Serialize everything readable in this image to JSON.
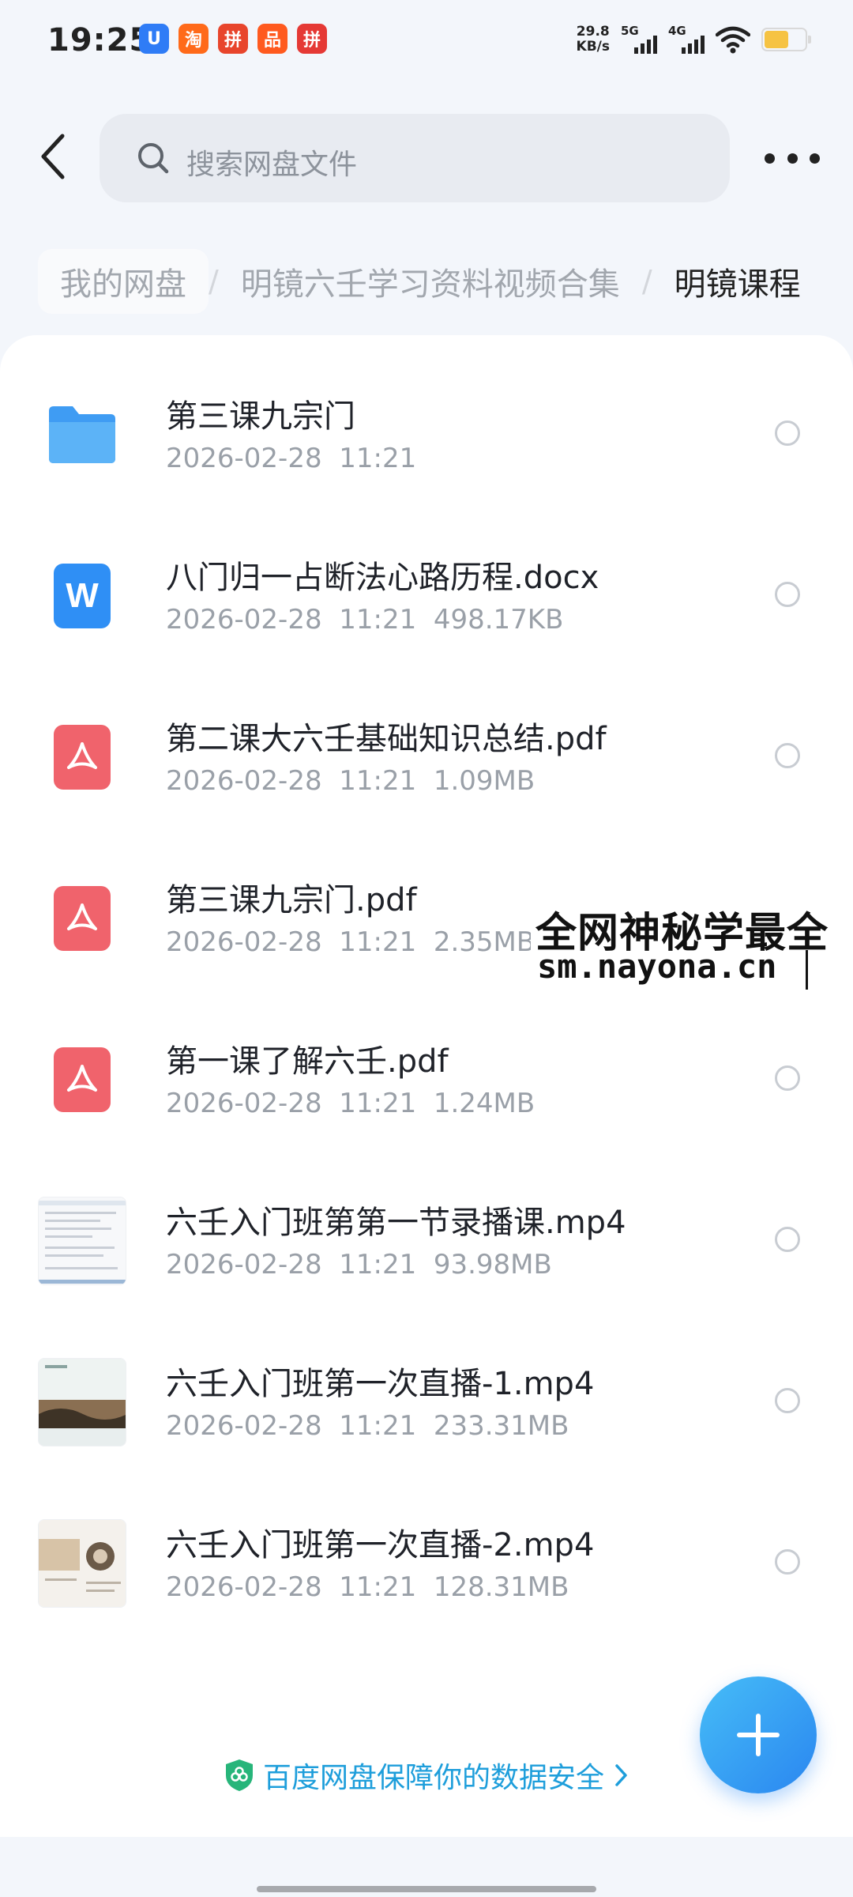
{
  "status_bar": {
    "time": "19:25",
    "net_speed_value": "29.8",
    "net_speed_unit": "KB/s",
    "sim1_label": "5G",
    "sim2_label": "4G",
    "battery_level": 0.6,
    "battery_color": "#f6c343",
    "notification_icons": [
      "U",
      "淘",
      "拼",
      "品",
      "拼"
    ]
  },
  "header": {
    "search_placeholder": "搜索网盘文件"
  },
  "breadcrumb": [
    "我的网盘",
    "明镜六壬学习资料视频合集",
    "明镜课程"
  ],
  "breadcrumb_separator": "/",
  "files": [
    {
      "name": "第三课九宗门",
      "date": "2026-02-28",
      "time": "11:21",
      "size": "",
      "type": "folder"
    },
    {
      "name": "八门归一占断法心路历程.docx",
      "date": "2026-02-28",
      "time": "11:21",
      "size": "498.17KB",
      "type": "word"
    },
    {
      "name": "第二课大六壬基础知识总结.pdf",
      "date": "2026-02-28",
      "time": "11:21",
      "size": "1.09MB",
      "type": "pdf"
    },
    {
      "name": "第三课九宗门.pdf",
      "date": "2026-02-28",
      "time": "11:21",
      "size": "2.35MB",
      "type": "pdf"
    },
    {
      "name": "第一课了解六壬.pdf",
      "date": "2026-02-28",
      "time": "11:21",
      "size": "1.24MB",
      "type": "pdf"
    },
    {
      "name": "六壬入门班第第一节录播课.mp4",
      "date": "2026-02-28",
      "time": "11:21",
      "size": "93.98MB",
      "type": "video"
    },
    {
      "name": "六壬入门班第一次直播-1.mp4",
      "date": "2026-02-28",
      "time": "11:21",
      "size": "233.31MB",
      "type": "video"
    },
    {
      "name": "六壬入门班第一次直播-2.mp4",
      "date": "2026-02-28",
      "time": "11:21",
      "size": "128.31MB",
      "type": "video"
    }
  ],
  "watermark": {
    "line1": "全网神秘学最全",
    "line2": "sm.nayona.cn"
  },
  "footer": {
    "security_text": "百度网盘保障你的数据安全"
  },
  "colors": {
    "accent": "#2a86f0",
    "pdf": "#f0636c",
    "word": "#2f8ff5",
    "folder": "#4aa6f5",
    "footer_link": "#1e9edb"
  }
}
